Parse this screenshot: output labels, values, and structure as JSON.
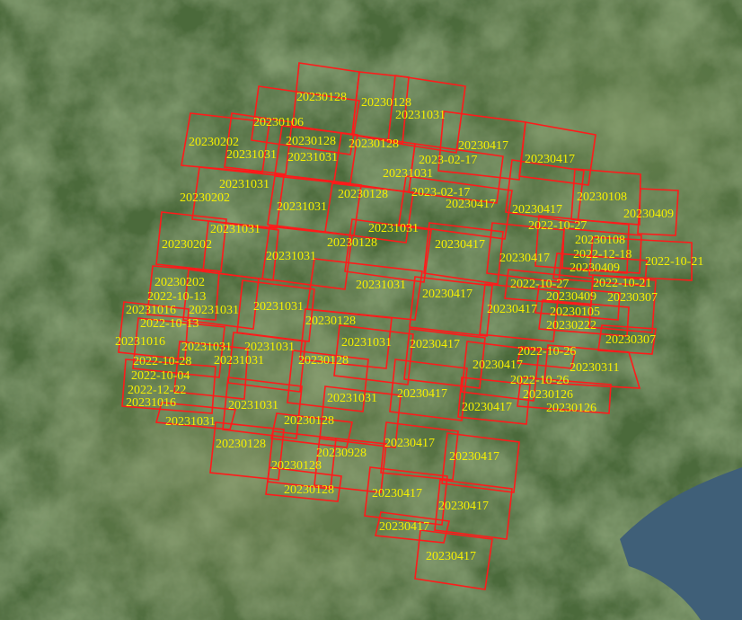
{
  "colors": {
    "footprint_stroke": "#ff1a1a",
    "label_text": "#f5f000",
    "terrain_base": "#4d6b3c",
    "terrain_dark": "#2f4a26",
    "terrain_light": "#6f8a56",
    "water": "#3f5f78"
  },
  "map": {
    "basemap": "satellite imagery",
    "overlay": "image footprint polygons",
    "labels": [
      "20230128",
      "20230128",
      "20231031",
      "20230106",
      "20230202",
      "20230128",
      "20230128",
      "20230417",
      "20231031",
      "20231031",
      "2023-02-17",
      "20230417",
      "20231031",
      "20231031",
      "20230202",
      "20230128",
      "2023-02-17",
      "20230108",
      "20230417",
      "20230409",
      "20231031",
      "20230417",
      "2022-10-27",
      "20230108",
      "20231031",
      "20231031",
      "20230202",
      "20230128",
      "20230417",
      "20230417",
      "2022-12-18",
      "2022-10-21",
      "20231031",
      "20230409",
      "20230202",
      "20231031",
      "20230417",
      "2022-10-27",
      "2022-10-21",
      "2022-10-13",
      "20230409",
      "20230307",
      "20231016",
      "20231031",
      "20231031",
      "20230417",
      "20230105",
      "2022-10-13",
      "20230128",
      "20230222",
      "20231016",
      "20231031",
      "20231031",
      "20231031",
      "20230417",
      "20230307",
      "2022-10-28",
      "20231031",
      "2022-10-26",
      "20230128",
      "20230417",
      "20230311",
      "2022-10-04",
      "2022-10-26",
      "2022-12-22",
      "20231031",
      "20230417",
      "20230126",
      "20231016",
      "20231031",
      "20230417",
      "20230126",
      "20231031",
      "20230128",
      "20230128",
      "20230417",
      "20230928",
      "20230417",
      "20230128",
      "20230128",
      "20230417",
      "20230417",
      "20230417",
      "20230417"
    ]
  }
}
